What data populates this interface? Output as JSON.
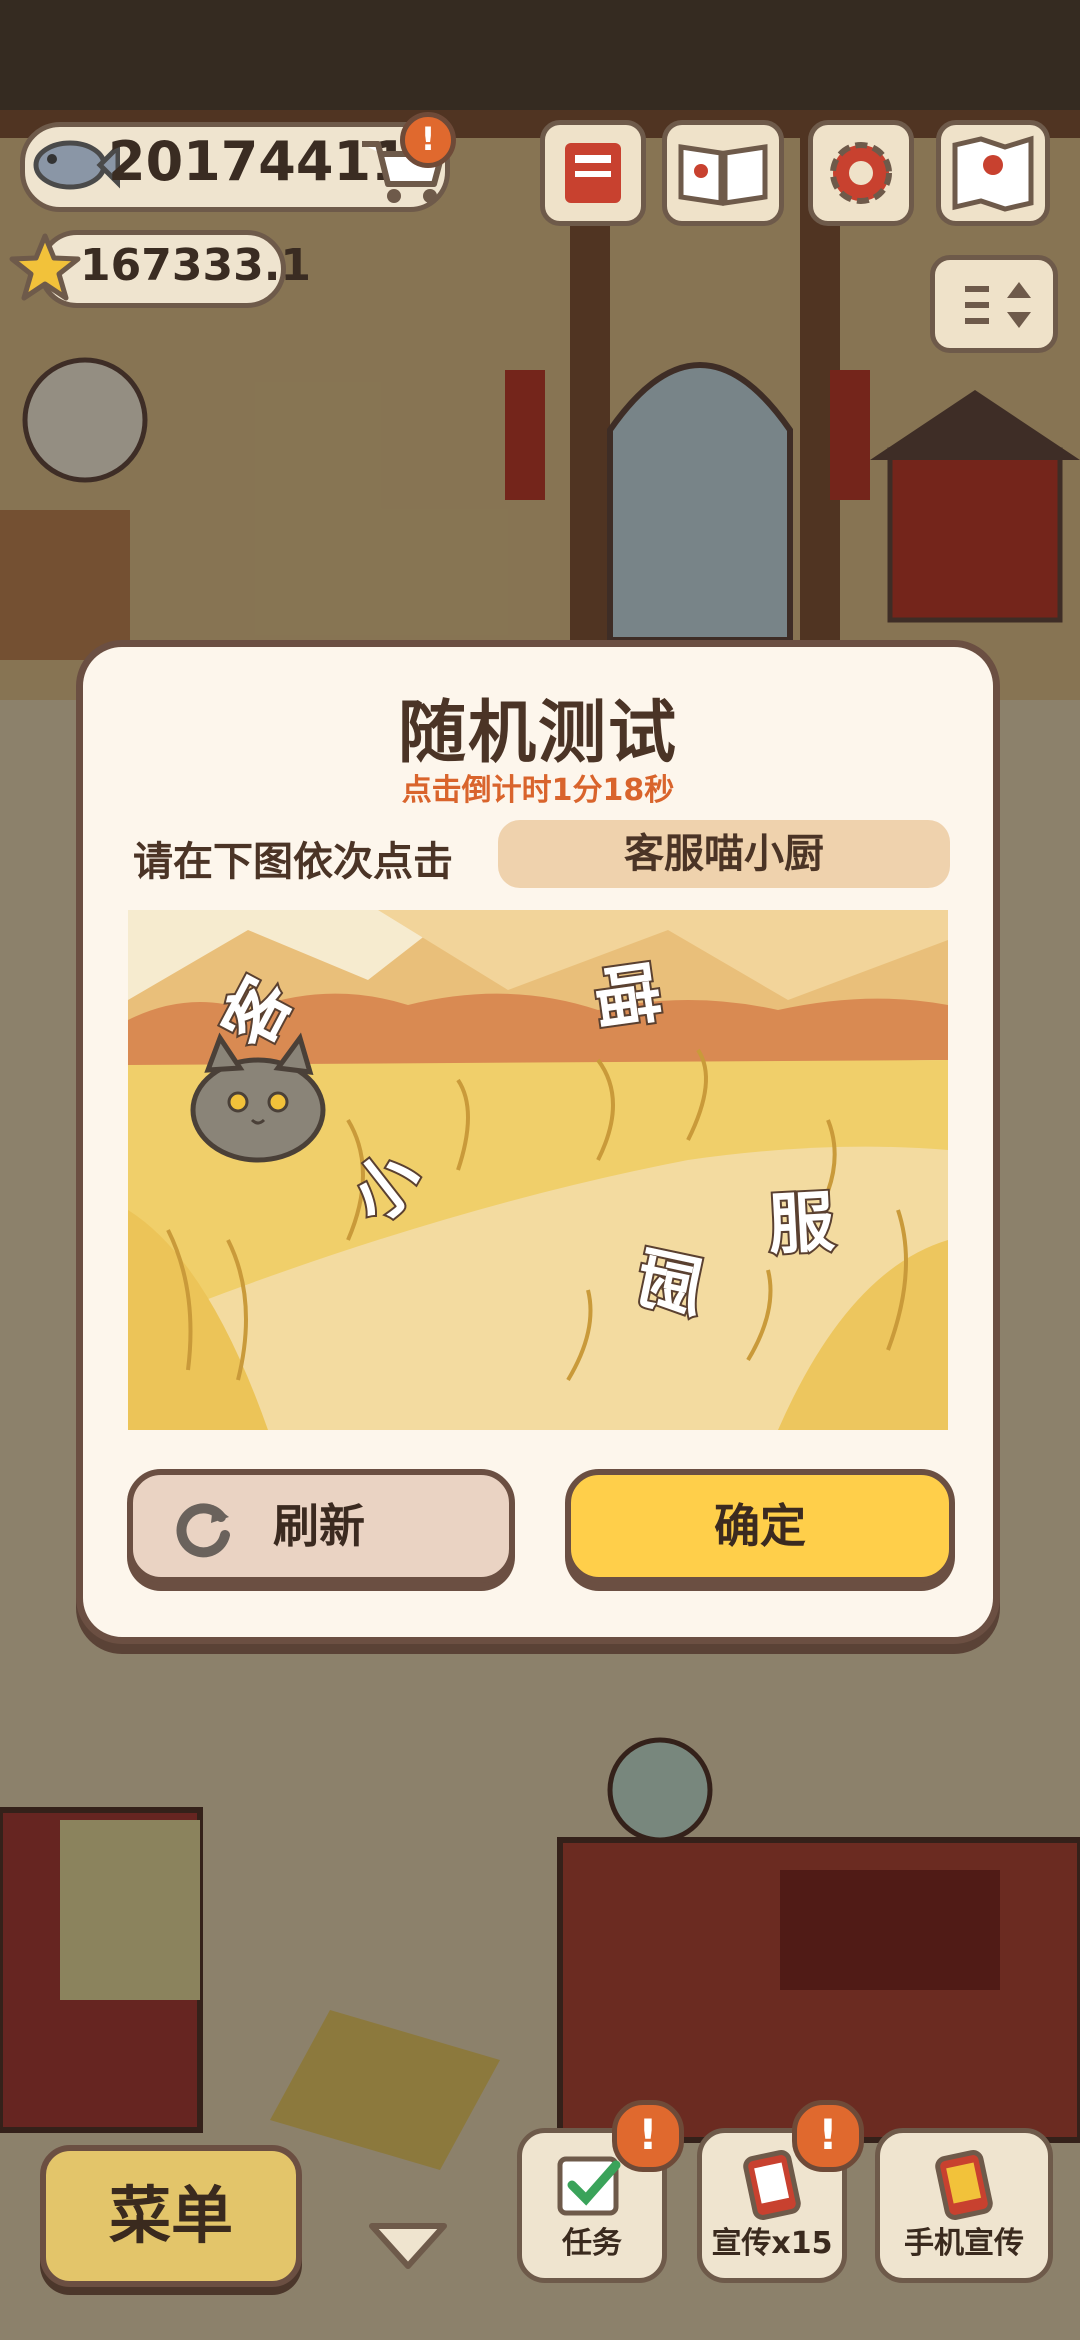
{
  "hud": {
    "fish_count": "20174411",
    "star_count": "167333.1",
    "alert_badge": "!"
  },
  "modal": {
    "title": "随机测试",
    "timer": "点击倒计时1分18秒",
    "prompt": "请在下图依次点击",
    "target_sequence": "客服喵小厨",
    "captcha_chars": [
      "客",
      "喵",
      "小",
      "服",
      "厨"
    ],
    "refresh_label": "刷新",
    "confirm_label": "确定"
  },
  "bottom_bar": {
    "menu_label": "菜单",
    "task_label": "任务",
    "promote_label": "宣传x15",
    "phone_promote_label": "手机宣传",
    "task_badge": "!",
    "promote_badge": "!"
  },
  "colors": {
    "accent_orange": "#d9642c",
    "confirm_yellow": "#ffcf4a",
    "border_brown": "#6b4f42",
    "modal_bg": "#fdf6ec"
  }
}
